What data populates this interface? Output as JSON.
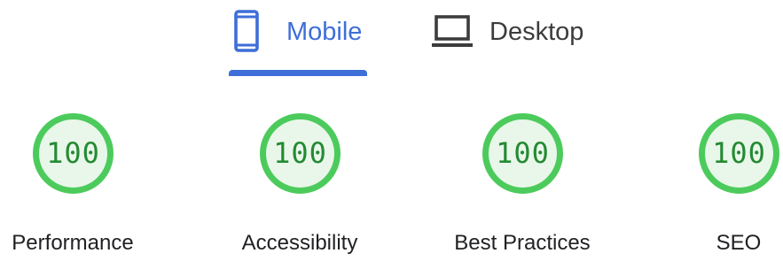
{
  "tabs": [
    {
      "label": "Mobile",
      "icon": "mobile-phone-icon",
      "selected": true
    },
    {
      "label": "Desktop",
      "icon": "laptop-icon",
      "selected": false
    }
  ],
  "colors": {
    "accent": "#3e6ed8",
    "pass_ring": "#4ccb5c",
    "pass_fill": "#e9f7ea",
    "pass_text": "#248a33",
    "tab_inactive": "#3c3c3c"
  },
  "scores": [
    {
      "label": "Performance",
      "value": "100"
    },
    {
      "label": "Accessibility",
      "value": "100"
    },
    {
      "label": "Best Practices",
      "value": "100"
    },
    {
      "label": "SEO",
      "value": "100"
    }
  ]
}
